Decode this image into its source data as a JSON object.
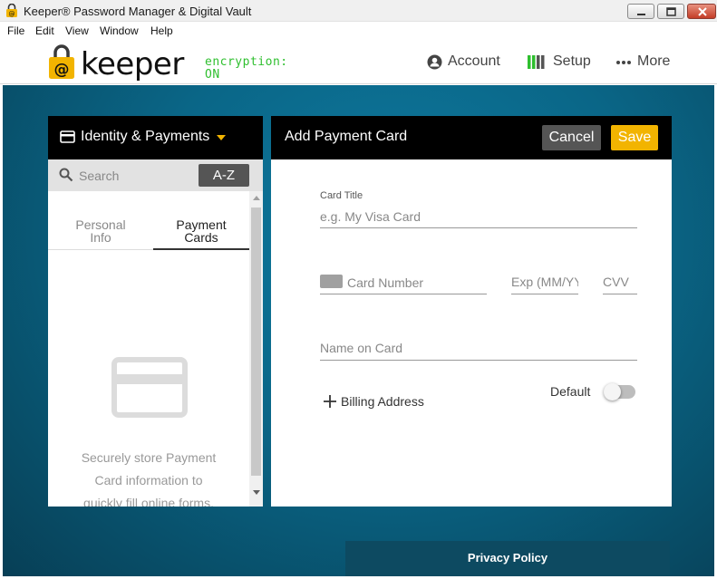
{
  "window": {
    "title": "Keeper® Password Manager & Digital Vault"
  },
  "menu": [
    "File",
    "Edit",
    "View",
    "Window",
    "Help"
  ],
  "header": {
    "logo_text": "keeper",
    "encryption_label": "encryption:",
    "encryption_status": "ON",
    "nav": {
      "account": "Account",
      "setup": "Setup",
      "more": "More"
    }
  },
  "sidebar": {
    "category": "Identity & Payments",
    "search_placeholder": "Search",
    "sort_label": "A-Z",
    "tabs": [
      {
        "line1": "Personal",
        "line2": "Info",
        "active": false
      },
      {
        "line1": "Payment",
        "line2": "Cards",
        "active": true
      }
    ],
    "empty_message_lines": [
      "Securely store Payment",
      "Card information to",
      "quickly fill online forms."
    ]
  },
  "form": {
    "title": "Add Payment Card",
    "cancel_label": "Cancel",
    "save_label": "Save",
    "card_title_label": "Card Title",
    "card_title_placeholder": "e.g. My Visa Card",
    "card_number_placeholder": "Card Number",
    "exp_placeholder": "Exp (MM/YY)",
    "cvv_placeholder": "CVV",
    "name_placeholder": "Name on Card",
    "billing_label": "Billing Address",
    "default_label": "Default",
    "default_on": false
  },
  "footer": {
    "privacy_policy": "Privacy Policy"
  },
  "colors": {
    "accent_yellow": "#f2b400",
    "encryption_green": "#2fbf2f",
    "header_black": "#000000",
    "background_blue": "#0a6687"
  }
}
